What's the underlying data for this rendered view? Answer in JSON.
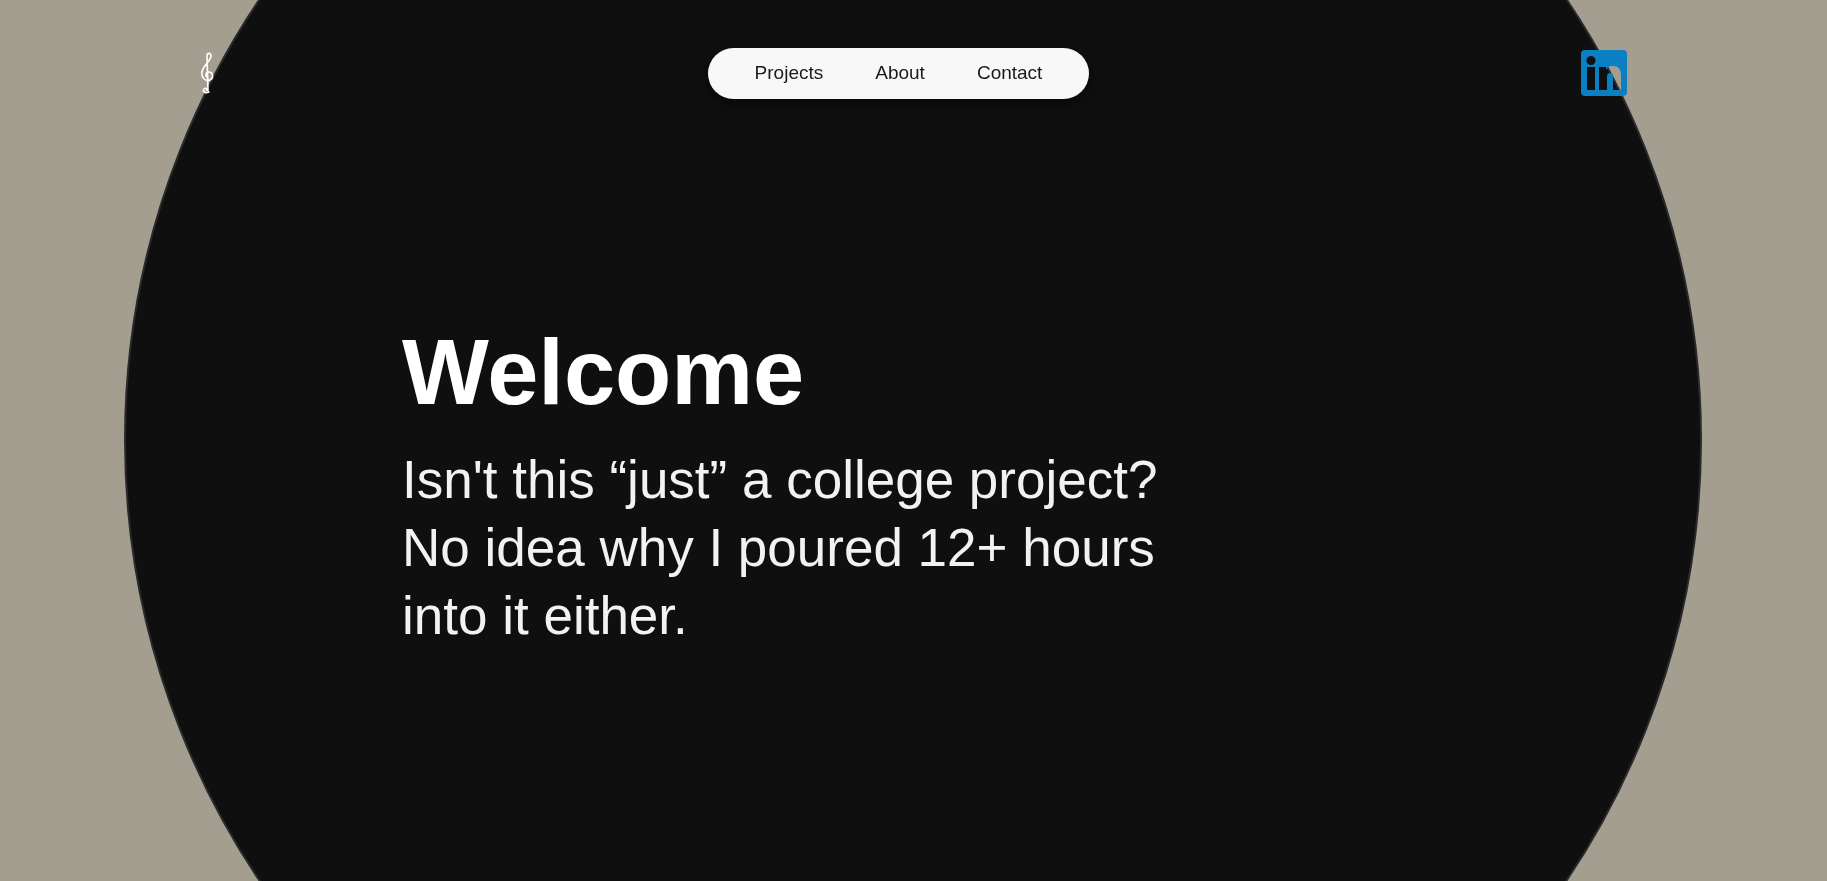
{
  "nav": {
    "links": [
      {
        "label": "Projects"
      },
      {
        "label": "About"
      },
      {
        "label": "Contact"
      }
    ]
  },
  "hero": {
    "title": "Welcome",
    "subtitle": "Isn't this “just” a college project? No idea why I poured 12+ hours into it either."
  }
}
